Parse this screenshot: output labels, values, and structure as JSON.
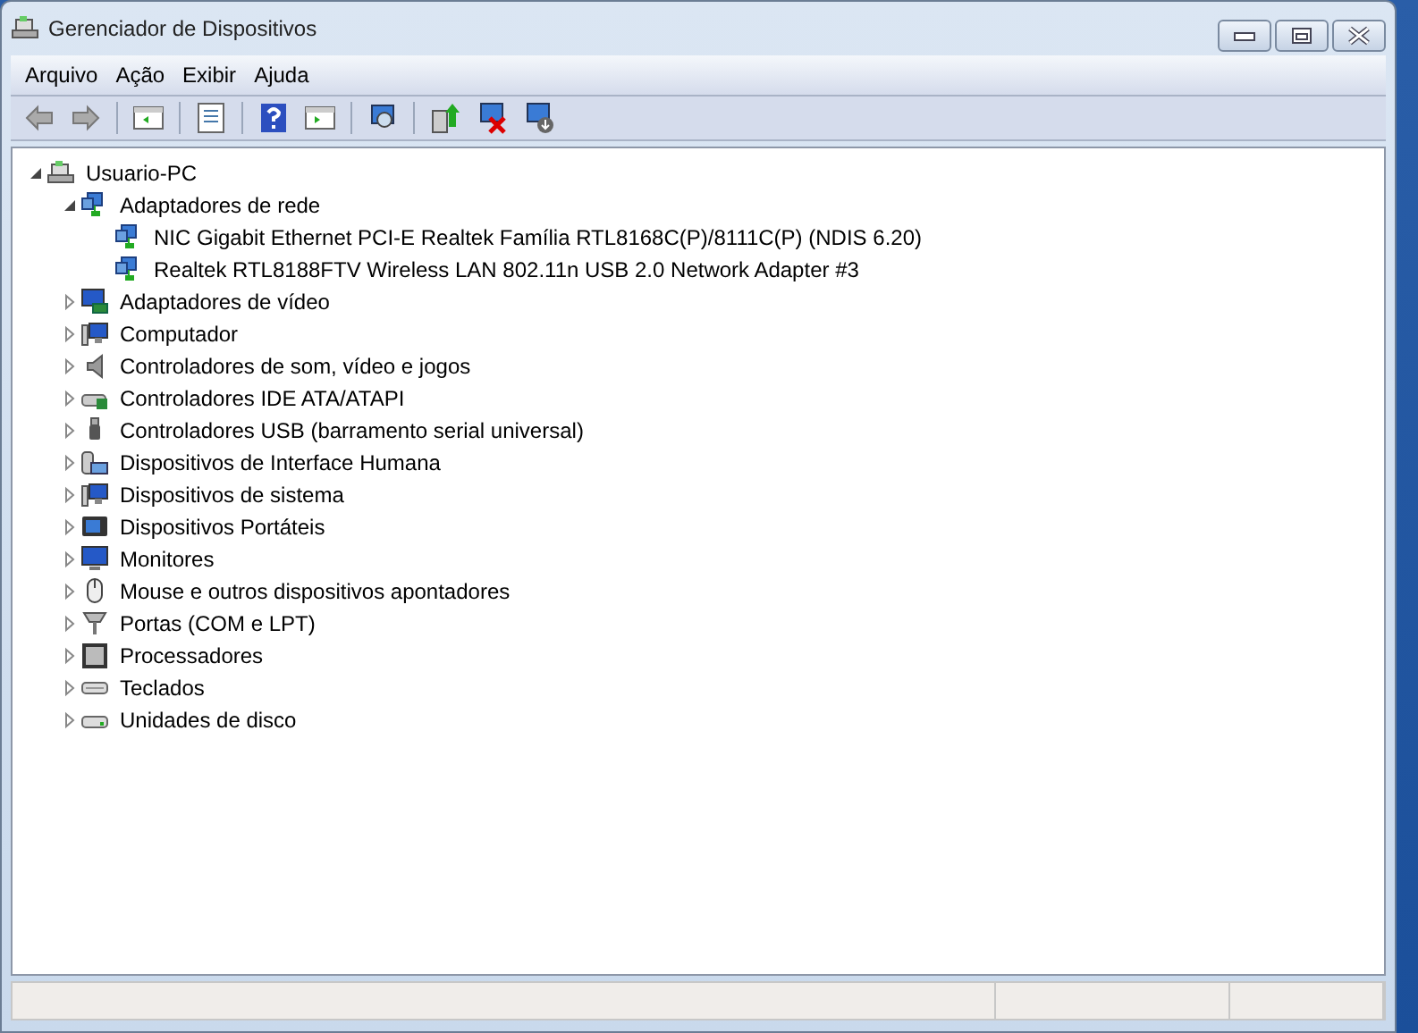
{
  "window": {
    "title": "Gerenciador de Dispositivos"
  },
  "menu": [
    {
      "label": "Arquivo"
    },
    {
      "label": "Ação"
    },
    {
      "label": "Exibir"
    },
    {
      "label": "Ajuda"
    }
  ],
  "toolbar": [
    {
      "kind": "back",
      "disabled": true
    },
    {
      "kind": "forward",
      "disabled": true
    },
    {
      "kind": "sep"
    },
    {
      "kind": "tree",
      "disabled": false
    },
    {
      "kind": "sep"
    },
    {
      "kind": "properties",
      "disabled": false
    },
    {
      "kind": "sep"
    },
    {
      "kind": "help",
      "disabled": false
    },
    {
      "kind": "pane",
      "disabled": false
    },
    {
      "kind": "sep"
    },
    {
      "kind": "scan",
      "disabled": false
    },
    {
      "kind": "sep"
    },
    {
      "kind": "update",
      "disabled": false
    },
    {
      "kind": "uninstall",
      "disabled": false
    },
    {
      "kind": "disable",
      "disabled": false
    }
  ],
  "tree": [
    {
      "label": "Usuario-PC",
      "kind": "computer",
      "expanded": true,
      "children": [
        {
          "label": "Adaptadores de rede",
          "kind": "network",
          "expanded": true,
          "children": [
            {
              "label": "NIC Gigabit Ethernet PCI-E Realtek Família RTL8168C(P)/8111C(P) (NDIS 6.20)",
              "kind": "network"
            },
            {
              "label": "Realtek RTL8188FTV Wireless LAN 802.11n USB 2.0 Network Adapter #3",
              "kind": "network"
            }
          ]
        },
        {
          "label": "Adaptadores de vídeo",
          "kind": "display",
          "expanded": false
        },
        {
          "label": "Computador",
          "kind": "pc",
          "expanded": false
        },
        {
          "label": "Controladores de som, vídeo e jogos",
          "kind": "speaker",
          "expanded": false
        },
        {
          "label": "Controladores IDE ATA/ATAPI",
          "kind": "drive",
          "expanded": false
        },
        {
          "label": "Controladores USB (barramento serial universal)",
          "kind": "usb",
          "expanded": false
        },
        {
          "label": "Dispositivos de Interface Humana",
          "kind": "hid",
          "expanded": false
        },
        {
          "label": "Dispositivos de sistema",
          "kind": "pc",
          "expanded": false
        },
        {
          "label": "Dispositivos Portáteis",
          "kind": "portable",
          "expanded": false
        },
        {
          "label": "Monitores",
          "kind": "monitor",
          "expanded": false
        },
        {
          "label": "Mouse e outros dispositivos apontadores",
          "kind": "mouse",
          "expanded": false
        },
        {
          "label": "Portas (COM e LPT)",
          "kind": "port",
          "expanded": false
        },
        {
          "label": "Processadores",
          "kind": "cpu",
          "expanded": false
        },
        {
          "label": "Teclados",
          "kind": "keyboard",
          "expanded": false
        },
        {
          "label": "Unidades de disco",
          "kind": "disk",
          "expanded": false
        }
      ]
    }
  ]
}
